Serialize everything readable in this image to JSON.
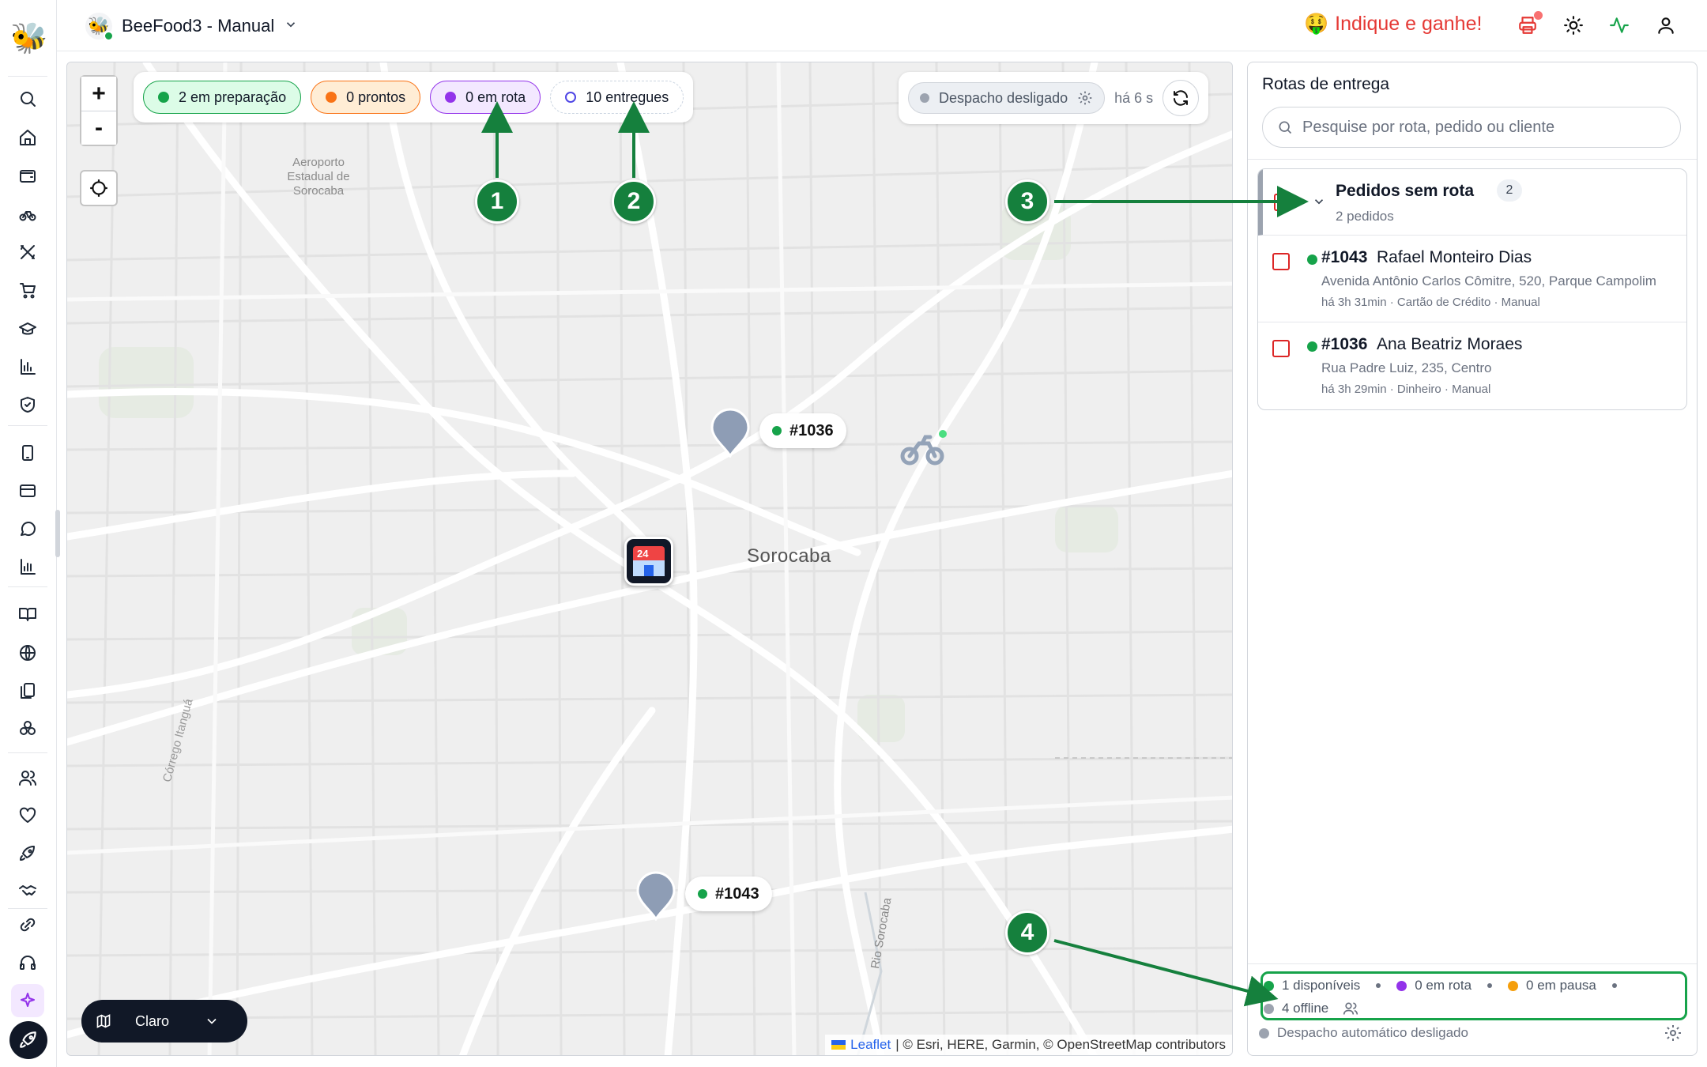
{
  "header": {
    "store_name": "BeeFood3 - Manual",
    "store_logo_icon": "bee-icon",
    "refer_emoji": "🤑",
    "refer_label": "Indique e ganhe!",
    "icons": [
      "printer-icon",
      "sun-icon",
      "activity-icon",
      "user-icon"
    ]
  },
  "sidebar": {
    "logo": "🐝",
    "items": [
      "search-icon",
      "home-icon",
      "wallet-icon",
      "bike-icon",
      "utensils-icon",
      "cart-icon",
      "chef-hat-icon",
      "chart-icon",
      "shield-icon",
      "tablet-icon",
      "card-icon",
      "chat-icon",
      "chart-bars-icon",
      "book-icon",
      "globe-icon",
      "copy-icon",
      "modules-icon",
      "users-icon",
      "heart-icon",
      "rocket-icon",
      "handshake-icon",
      "link-icon",
      "headset-icon",
      "sparkles-icon"
    ],
    "launch_icon": "rocket-icon"
  },
  "map": {
    "zoom_in": "+",
    "zoom_out": "-",
    "status_chips": {
      "preparing": "2 em preparação",
      "ready": "0 prontos",
      "on_route": "0 em rota",
      "delivered": "10 entregues"
    },
    "dispatch": {
      "label": "Despacho desligado",
      "updated": "há 6 s"
    },
    "city_label": "Sorocaba",
    "airport_label": "Aeroporto Estadual de Sorocaba",
    "river_labels": [
      "Rio Sorocaba",
      "Córrego Itanguá"
    ],
    "pins": [
      {
        "label": "#1036"
      },
      {
        "label": "#1043"
      }
    ],
    "store_marker_tag": "24",
    "theme": {
      "label": "Claro"
    },
    "attribution": {
      "link": "Leaflet",
      "text": "| © Esri, HERE, Garmin, © OpenStreetMap contributors"
    }
  },
  "annotations": [
    "1",
    "2",
    "3",
    "4"
  ],
  "panel": {
    "title": "Rotas de entrega",
    "search_placeholder": "Pesquise por rota, pedido ou cliente",
    "group": {
      "title": "Pedidos sem rota",
      "count": "2",
      "subtitle": "2 pedidos"
    },
    "orders": [
      {
        "id": "#1043",
        "name": "Rafael Monteiro Dias",
        "address": "Avenida Antônio Carlos Cômitre, 520, Parque Campolim",
        "meta": "há 3h 31min · Cartão de Crédito · Manual"
      },
      {
        "id": "#1036",
        "name": "Ana Beatriz Moraes",
        "address": "Rua Padre Luiz, 235, Centro",
        "meta": "há 3h 29min · Dinheiro · Manual"
      }
    ],
    "drivers": {
      "available": "1 disponíveis",
      "on_route": "0 em rota",
      "paused": "0 em pausa",
      "offline": "4 offline"
    },
    "auto_dispatch": "Despacho automático desligado"
  },
  "colors": {
    "green": "#16a34a",
    "orange": "#f97316",
    "purple": "#9333ea",
    "annotation": "#15803d",
    "pin": "#8e9db5"
  }
}
